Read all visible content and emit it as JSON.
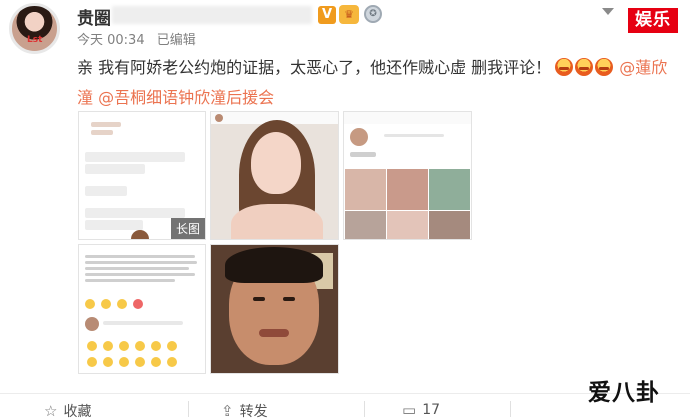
{
  "post": {
    "username": "贵圈",
    "verified_badge": "V",
    "time": "今天 00:34",
    "edited": "已编辑",
    "text_prefix": "亲 我有阿娇老公约炮的证据，太恶心了，他还作贼心虚 删我评论！",
    "mention_1": "@蓮欣潼",
    "mention_2": "@吾桐细语钟欣潼后援会",
    "emoji_name": "angry-face-icon",
    "images": [
      {
        "name": "chat-screenshot",
        "long_tag": "长图"
      },
      {
        "name": "selfie-photo"
      },
      {
        "name": "profile-grid"
      },
      {
        "name": "comment-screenshot"
      },
      {
        "name": "video-still"
      }
    ]
  },
  "brand_box": "娱乐",
  "actions": {
    "favorite_label": "收藏",
    "repost_label": "转发",
    "comment_count": "17"
  },
  "watermark": "爱八卦",
  "colors": {
    "accent": "#eb7350",
    "brand_red": "#e60012"
  }
}
